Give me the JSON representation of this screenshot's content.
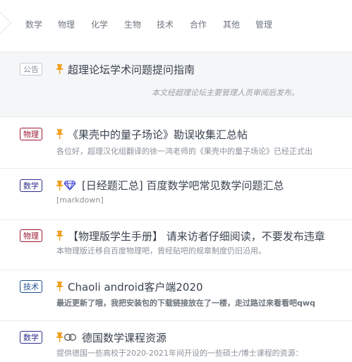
{
  "nav": {
    "items": [
      "数学",
      "物理",
      "化学",
      "生物",
      "技术",
      "合作",
      "其他",
      "管理"
    ]
  },
  "colors": {
    "announcement": "#8b929a",
    "physics": "#9b1b30",
    "math": "#2d2f8c",
    "tech": "#1d4f8f",
    "pin": "#f0a020"
  },
  "threads": [
    {
      "tag": "公告",
      "title": "超理论坛学术问题提问指南",
      "excerpt": "本文经超理论坛主要管理人员审阅后发布。"
    },
    {
      "tag": "物理",
      "title": "《果壳中的量子场论》勘误收集汇总帖",
      "excerpt": "各位好，超理汉化组翻译的徐一鸿老师的《果壳中的量子场论》已经正式出"
    },
    {
      "tag": "数学",
      "title": "[日经题汇总] 百度数学吧常见数学问题汇总",
      "excerpt": "[markdown]",
      "icon": "diamond-icon"
    },
    {
      "tag": "物理",
      "title": "【物理版学生手册】 请来访者仔细阅读，不要发布违章",
      "excerpt": "本物理版迁移自百度物理吧，曾经贴吧的规章制度仍旧沿用。"
    },
    {
      "tag": "技术",
      "title": "Chaoli android客户端2020",
      "excerpt": "最近更新了哦，我把安装包的下载链接放在了一楼，走过路过来看看吧qwq"
    },
    {
      "tag": "数学",
      "title": "德国数学课程资源",
      "excerpt": "提供德国一些高校于2020-2021年间开设的一些硕士/博士课程的资源：",
      "icon": "link-icon"
    }
  ]
}
